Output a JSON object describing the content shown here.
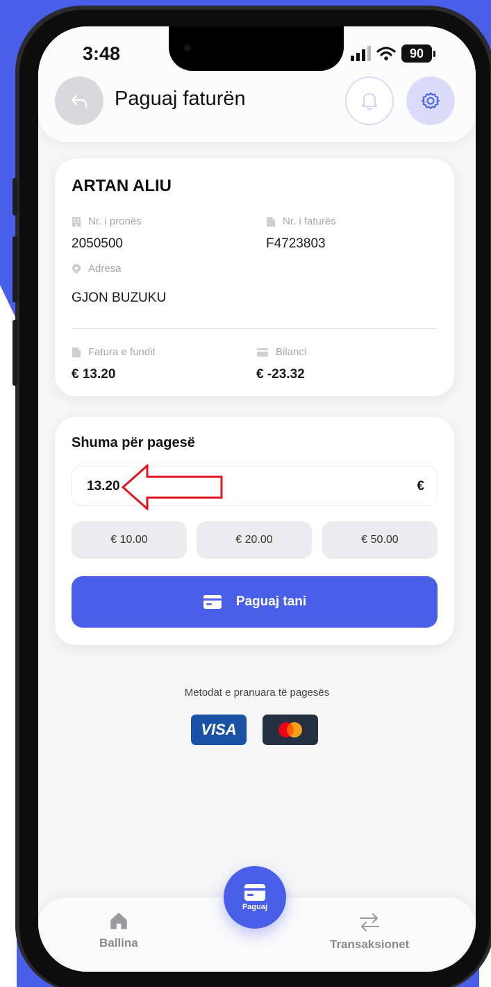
{
  "status": {
    "time": "3:48",
    "battery": "90"
  },
  "header": {
    "title": "Paguaj faturën"
  },
  "account": {
    "name": "ARTAN ALIU",
    "property_label": "Nr. i pronës",
    "property_value": "2050500",
    "invoice_label": "Nr. i faturës",
    "invoice_value": "F4723803",
    "address_label": "Adresa",
    "address_value": "GJON BUZUKU",
    "last_invoice_label": "Fatura e fundit",
    "last_invoice_value": "€ 13.20",
    "balance_label": "Bilanci",
    "balance_value": "€ -23.32"
  },
  "payment": {
    "title": "Shuma për pagesë",
    "amount": "13.20",
    "currency": "€",
    "quick_amounts": [
      "€ 10.00",
      "€ 20.00",
      "€ 50.00"
    ],
    "pay_button": "Paguaj tani"
  },
  "methods": {
    "label": "Metodat e pranuara të pagesës",
    "visa": "VISA"
  },
  "nav": {
    "home": "Ballina",
    "pay": "Paguaj",
    "transactions": "Transaksionet"
  },
  "colors": {
    "accent": "#4a5fe8",
    "annotation": "#e0141e"
  }
}
